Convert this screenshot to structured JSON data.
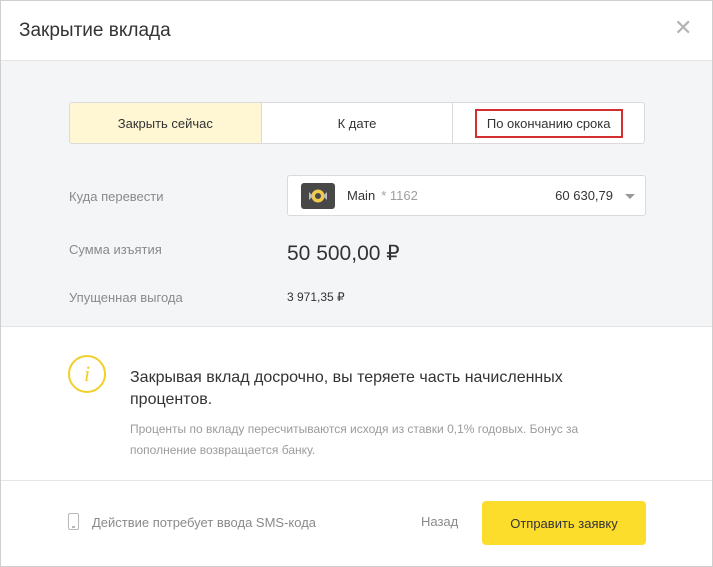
{
  "dialog": {
    "title": "Закрытие вклада",
    "close_icon": "close-icon"
  },
  "tabs": [
    {
      "label": "Закрыть сейчас",
      "active": true
    },
    {
      "label": "К дате",
      "active": false
    },
    {
      "label": "По окончанию срока",
      "active": false
    }
  ],
  "form": {
    "destination_label": "Куда перевести",
    "account": {
      "icon": "bank-card-icon",
      "name": "Main",
      "number": "* 1162",
      "balance": "60 630,79"
    },
    "withdrawal_label": "Сумма изъятия",
    "withdrawal_amount": "50 500,00 ₽",
    "lost_profit_label": "Упущенная выгода",
    "lost_profit_amount": "3 971,35 ₽"
  },
  "warning": {
    "icon": "info-icon",
    "title": "Закрывая вклад досрочно, вы теряете часть начисленных процентов.",
    "text": "Проценты по вкладу пересчитываются исходя из ставки 0,1% годовых. Бонус за пополнение возвращается банку."
  },
  "footer": {
    "sms_note": "Действие потребует ввода SMS-кода",
    "back_label": "Назад",
    "submit_label": "Отправить заявку"
  },
  "colors": {
    "accent": "#fddd2c",
    "active_tab": "#fff6d4",
    "highlight": "#d32f2f"
  }
}
